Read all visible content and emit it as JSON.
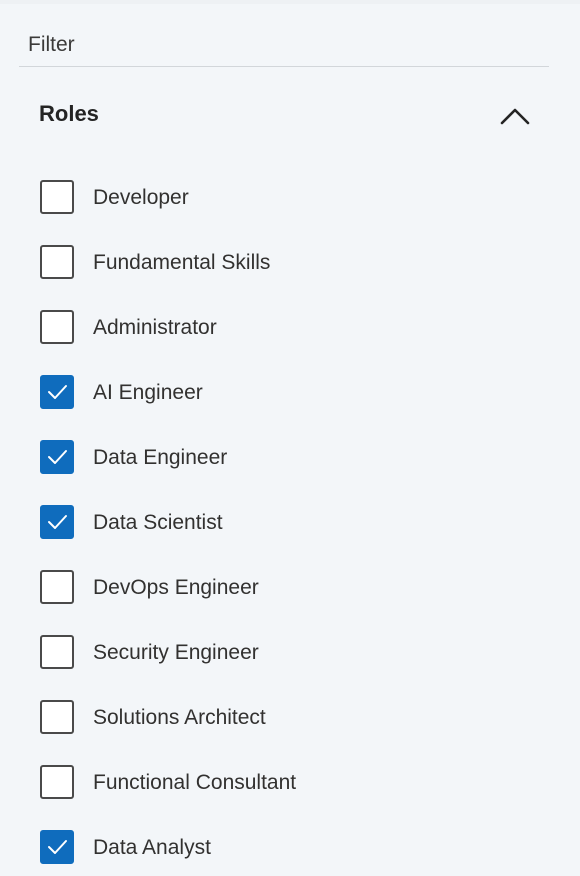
{
  "filter": {
    "label": "Filter"
  },
  "section": {
    "title": "Roles",
    "expanded": true,
    "chevron_icon": "chevron-up-icon"
  },
  "colors": {
    "accent": "#0f6cbd",
    "unchecked_border": "#4a4a4a",
    "background": "#f3f6f9"
  },
  "roles": [
    {
      "label": "Developer",
      "checked": false
    },
    {
      "label": "Fundamental Skills",
      "checked": false
    },
    {
      "label": "Administrator",
      "checked": false
    },
    {
      "label": "AI Engineer",
      "checked": true
    },
    {
      "label": "Data Engineer",
      "checked": true
    },
    {
      "label": "Data Scientist",
      "checked": true
    },
    {
      "label": "DevOps Engineer",
      "checked": false
    },
    {
      "label": "Security Engineer",
      "checked": false
    },
    {
      "label": "Solutions Architect",
      "checked": false
    },
    {
      "label": "Functional Consultant",
      "checked": false
    },
    {
      "label": "Data Analyst",
      "checked": true
    }
  ]
}
